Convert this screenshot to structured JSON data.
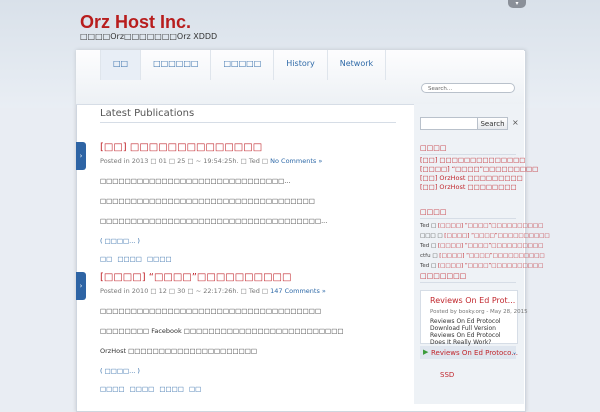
{
  "site": {
    "title": "Orz Host Inc.",
    "tagline": "□□□□Orz□□□□□□□Orz XDDD",
    "tab_icon": "▾"
  },
  "nav": [
    "□□",
    "□□□□□□",
    "□□□□□",
    "History",
    "Network"
  ],
  "search_top": {
    "placeholder": "Search..."
  },
  "main": {
    "heading": "Latest Publications"
  },
  "posts": [
    {
      "title": "[□□] □□□□□□□□□□□□□□",
      "meta": "Posted in 2013 □ 01 □ 25 □ ~ 19:54:25h. □ Ted □ ",
      "comments": "No Comments »",
      "p1": "□□□□□□□□□□□□□□□□□□□□□□□□□□□□□□...",
      "p2": "□□□□□□□□□□□□□□□□□□□□□□□□□□□□□□□□□□□",
      "p3": "□□□□□□□□□□□□□□□□□□□□□□□□□□□□□□□□□□□□...",
      "more": "( □□□□... )",
      "tags": [
        "□□",
        "□□□□",
        "□□□□"
      ]
    },
    {
      "title": "[□□□□] “□□□□”□□□□□□□□□□",
      "meta": "Posted in 2010 □ 12 □ 30 □ ~ 22:17:26h. □ Ted □ ",
      "comments": "147 Comments »",
      "p1": "□□□□□□□□□□□□□□□□□□□□□□□□□□□□□□□□□□□□",
      "p2": "□□□□□□□□ Facebook □□□□□□□□□□□□□□□□□□□□□□□□□□",
      "p3": "OrzHost □□□□□□□□□□□□□□□□□□□□□",
      "more": "( □□□□... )",
      "tags": [
        "□□□□",
        "□□□□",
        "□□□□",
        "□□"
      ]
    }
  ],
  "sidebar": {
    "search_button": "Search",
    "close_symbol": "×",
    "w1_title": "□□□□",
    "w1_items": [
      "[□□] □□□□□□□□□□□□□□",
      "[□□□□] “□□□□”□□□□□□□□□",
      "[□□] OrzHost □□□□□□□□□",
      "[□□] OrzHost □□□□□□□□"
    ],
    "w2_title": "□□□□",
    "w2_items": [
      {
        "prefix": "Ted □ ",
        "link": "[□□□□] “□□□□”□□□□□□□□□□"
      },
      {
        "prefix": "□□□ □ ",
        "link": "[□□□□] “□□□□”□□□□□□□□□□"
      },
      {
        "prefix": "Ted □ ",
        "link": "[□□□□] “□□□□”□□□□□□□□□□"
      },
      {
        "prefix": "ctfu □ ",
        "link": "[□□□□] “□□□□”□□□□□□□□□□"
      },
      {
        "prefix": "Ted □ ",
        "link": "[□□□□] “□□□□”□□□□□□□□□□"
      }
    ],
    "w3_title": "□□□□□□□",
    "feed": {
      "title": "Reviews On Ed Prot...",
      "sub": "Posted by bosky.org - May 28, 2015",
      "text": "Reviews On Ed Protocol Download Full Version Reviews On Ed Protocol Does It Really Work?",
      "item2": "Reviews On Ed Protoco...",
      "item4": "SSD"
    }
  }
}
